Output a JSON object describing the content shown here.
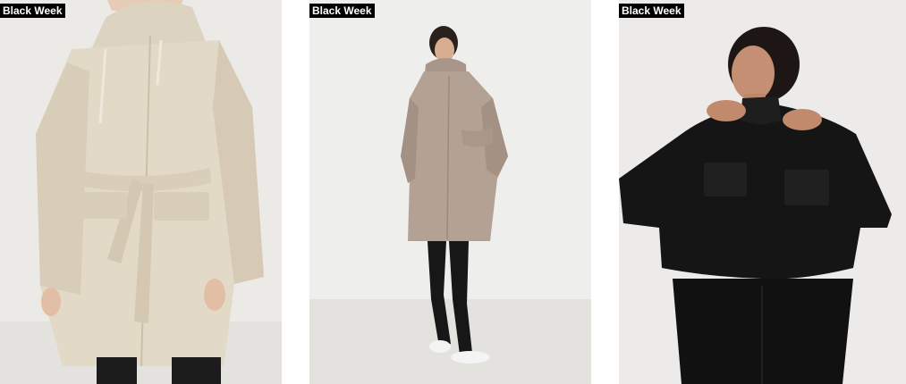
{
  "products": [
    {
      "badge": "Black Week",
      "image": "beige-belted-raincoat"
    },
    {
      "badge": "Black Week",
      "image": "taupe-hooded-raincoat"
    },
    {
      "badge": "Black Week",
      "image": "black-cropped-jacket"
    }
  ],
  "colors": {
    "badge_bg": "#000000",
    "badge_text": "#ffffff"
  }
}
